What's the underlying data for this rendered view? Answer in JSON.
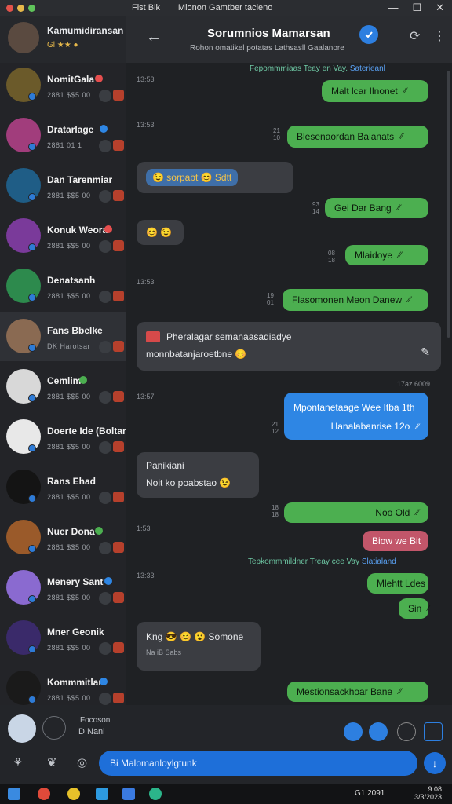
{
  "titlebar": {
    "app": "Fist Bik",
    "separator": "|",
    "window_title": "Mionon Gamtber tacieno",
    "minimize": "—",
    "maximize": "☐",
    "close": "✕",
    "traffic_colors": [
      "#e2534b",
      "#e6b84a",
      "#5fc45a"
    ]
  },
  "sidebar": {
    "me": {
      "name": "Kamumidiransan",
      "status": "Gl ★★ ●"
    },
    "contacts": [
      {
        "name": "NomitGala",
        "meta": "2881  $$5  00",
        "badge": "#e64e4e",
        "avatar": "#6b5a2a"
      },
      {
        "name": "Dratarlage",
        "meta": "2881  01   1",
        "badge": "#2e86e4",
        "avatar": "#a13d7c"
      },
      {
        "name": "Dan Tarenmiar",
        "meta": "2881  $$5  00",
        "badge": "",
        "avatar": "#1f5d86"
      },
      {
        "name": "Konuk Weora",
        "meta": "2881  $$5  00",
        "badge": "#e64e4e",
        "avatar": "#7a3a9a"
      },
      {
        "name": "Denatsanh",
        "meta": "2881  $$5  00",
        "badge": "",
        "avatar": "#2d8a4d"
      },
      {
        "name": "Fans Bbelke",
        "meta": "DK Harotsar",
        "badge": "",
        "avatar": "#8a6a52"
      },
      {
        "name": "Cemlim",
        "meta": "2881  $$5  00",
        "badge": "#4caf50",
        "avatar": "#d8d8d8"
      },
      {
        "name": "Doerte Ide (Boltament",
        "meta": "2881  $$5  00",
        "badge": "",
        "avatar": "#e8e8e8"
      },
      {
        "name": "Rans Ehad",
        "meta": "2881  $$5  00",
        "badge": "",
        "avatar": "#141414"
      },
      {
        "name": "Nuer Dona",
        "meta": "2881  $$5  00",
        "badge": "#4caf50",
        "avatar": "#9a5a2a"
      },
      {
        "name": "Menery Sant",
        "meta": "2881  $$5  00",
        "badge": "#2e86e4",
        "avatar": "#8a6ad0"
      },
      {
        "name": "Mner Geonik",
        "meta": "2881  $$5  00",
        "badge": "",
        "avatar": "#3a2a6a"
      },
      {
        "name": "Kommmitlar",
        "meta": "2881  $$5  00",
        "badge": "#2e86e4",
        "avatar": "#1a1a1a"
      }
    ]
  },
  "header": {
    "back": "←",
    "title": "Sorumnios Mamarsan",
    "subtitle": "Rohon omatikel potatas Lathsasll Gaalanore",
    "search": "⟳",
    "more": "⋮"
  },
  "messages": {
    "notice1": {
      "text": "Fepommmiaas Teay en Vay. ",
      "link": "Saterieanl"
    },
    "notice2": {
      "text": "Tepkommmildner Treay cee Vay ",
      "link": "Slatialand"
    },
    "times": [
      "13:53",
      "13:53",
      "13:53",
      "13:57",
      "1:53",
      "13:33"
    ],
    "ts_right": "17az 6009",
    "items": [
      {
        "text": "Malt lcar Ilnonet",
        "check": "⁄⁄"
      },
      {
        "text": "Blesenaordan Balanats",
        "check": "⁄⁄"
      },
      {
        "text": "😉 sorpabt 😊 Sdtt"
      },
      {
        "text": "Gei Dar Bang ",
        "check": "⁄⁄"
      },
      {
        "text": "😊 😉"
      },
      {
        "text": "Mlaidoye",
        "check": "⁄⁄"
      },
      {
        "text": "Flasomonen Meon Danew",
        "check": "⁄⁄"
      },
      {
        "line1": "Pheralagar semanaasadiadye",
        "line2": "monnbatanjaroetbne 😊"
      },
      {
        "line1": "Mpontanetaage Wee Itba 1th",
        "line2": "Hanalabanrise 12o",
        "check": "⁄⁄"
      },
      {
        "line1": "Panikiani",
        "line2": "Noit ko poabstao 😉"
      },
      {
        "text": "Noo Old",
        "check": "⁄⁄"
      },
      {
        "text": "Biow we Bit"
      },
      {
        "text": "Mlehtt Ldes"
      },
      {
        "text": "Sin",
        "check": "⁄"
      },
      {
        "line1": "Kng 😎 😊 😮 Somone",
        "line2": "Na   iB  Sabs"
      },
      {
        "text": "Mestionsackhoar Bane",
        "check": "⁄⁄"
      }
    ],
    "mini": [
      "21\n10",
      "93\n14",
      "08\n18",
      "19\n01",
      "21\n12",
      "18\n18"
    ]
  },
  "composer": {
    "label": "Focoson",
    "sub": "D  Nanl",
    "placeholder": "Bi Malomanloylgtunk",
    "send": "↓"
  },
  "taskbar": {
    "clock_time": "9:08",
    "clock_date": "3/3/2023",
    "tray": "G1 2091"
  }
}
